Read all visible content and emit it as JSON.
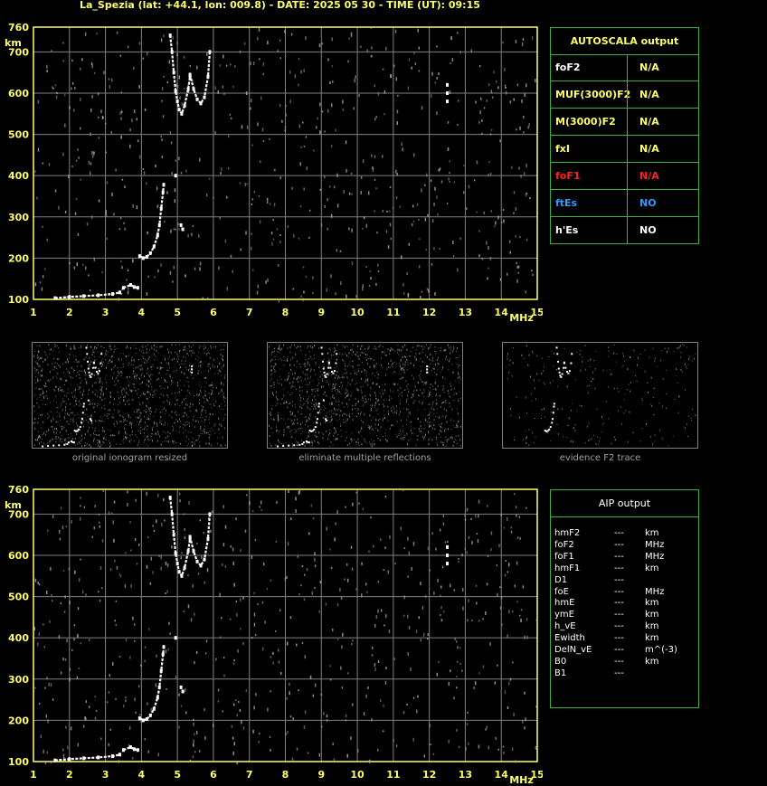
{
  "title": "La_Spezia (lat: +44.1, lon: 009.8) - DATE: 2025 05 30 - TIME (UT): 09:15",
  "colors": {
    "axis": "#ffff66",
    "grid": "#808080",
    "panel_border": "#3cb043",
    "trace": "#ffffff",
    "noise": "#b0b0b0"
  },
  "chart_data": [
    {
      "type": "scatter",
      "name": "main-ionogram",
      "xlabel": "MHz",
      "ylabel": "km",
      "xlim": [
        1,
        15
      ],
      "ylim": [
        100,
        760
      ],
      "x_ticks": [
        1,
        2,
        3,
        4,
        5,
        6,
        7,
        8,
        9,
        10,
        11,
        12,
        13,
        14,
        15
      ],
      "y_ticks": [
        100,
        200,
        300,
        400,
        500,
        600,
        700,
        760
      ],
      "grid": true,
      "traces": [
        {
          "label": "E-low",
          "points": [
            [
              1.6,
              103
            ],
            [
              2.0,
              106
            ],
            [
              2.4,
              108
            ],
            [
              2.8,
              110
            ],
            [
              3.2,
              113
            ],
            [
              3.4,
              117
            ]
          ]
        },
        {
          "label": "Es-low",
          "points": [
            [
              3.5,
              128
            ],
            [
              3.7,
              135
            ],
            [
              3.8,
              130
            ],
            [
              3.9,
              128
            ]
          ]
        },
        {
          "label": "F1",
          "points": [
            [
              3.95,
              205
            ],
            [
              4.05,
              200
            ],
            [
              4.15,
              203
            ],
            [
              4.25,
              212
            ],
            [
              4.35,
              228
            ],
            [
              4.45,
              255
            ],
            [
              4.5,
              280
            ],
            [
              4.55,
              320
            ],
            [
              4.6,
              360
            ],
            [
              4.62,
              378
            ]
          ]
        },
        {
          "label": "F2-o",
          "points": [
            [
              4.8,
              740
            ],
            [
              4.85,
              700
            ],
            [
              4.9,
              650
            ],
            [
              4.95,
              605
            ],
            [
              5.0,
              580
            ],
            [
              5.05,
              560
            ],
            [
              5.12,
              550
            ],
            [
              5.2,
              570
            ],
            [
              5.3,
              610
            ],
            [
              5.35,
              640
            ]
          ]
        },
        {
          "label": "F2-x",
          "points": [
            [
              5.35,
              645
            ],
            [
              5.45,
              610
            ],
            [
              5.55,
              585
            ],
            [
              5.65,
              575
            ],
            [
              5.75,
              590
            ],
            [
              5.85,
              640
            ],
            [
              5.9,
              700
            ]
          ]
        },
        {
          "label": "spur",
          "points": [
            [
              4.95,
              400
            ],
            [
              5.1,
              280
            ],
            [
              5.15,
              270
            ],
            [
              12.5,
              620
            ],
            [
              12.5,
              600
            ],
            [
              12.5,
              580
            ]
          ]
        }
      ]
    },
    {
      "type": "scatter",
      "name": "aip-ionogram",
      "xlabel": "MHz",
      "ylabel": "km",
      "xlim": [
        1,
        15
      ],
      "ylim": [
        100,
        760
      ],
      "x_ticks": [
        1,
        2,
        3,
        4,
        5,
        6,
        7,
        8,
        9,
        10,
        11,
        12,
        13,
        14,
        15
      ],
      "y_ticks": [
        100,
        200,
        300,
        400,
        500,
        600,
        700,
        760
      ],
      "grid": true
    }
  ],
  "thumbnails": [
    {
      "caption": "original ionogram resized"
    },
    {
      "caption": "eliminate multiple reflections"
    },
    {
      "caption": "evidence F2 trace"
    }
  ],
  "autoscala": {
    "header": "AUTOSCALA output",
    "rows": [
      {
        "key": "foF2",
        "value": "N/A",
        "key_color": "#ffffff",
        "value_color": "#ffff66"
      },
      {
        "key": "MUF(3000)F2",
        "value": "N/A",
        "key_color": "#ffff66",
        "value_color": "#ffff66"
      },
      {
        "key": "M(3000)F2",
        "value": "N/A",
        "key_color": "#ffff66",
        "value_color": "#ffff66"
      },
      {
        "key": "fxI",
        "value": "N/A",
        "key_color": "#ffff66",
        "value_color": "#ffff66"
      },
      {
        "key": "foF1",
        "value": "N/A",
        "key_color": "#ff2020",
        "value_color": "#ff2020"
      },
      {
        "key": "ftEs",
        "value": "NO",
        "key_color": "#3399ff",
        "value_color": "#3399ff"
      },
      {
        "key": "h'Es",
        "value": "NO",
        "key_color": "#ffffff",
        "value_color": "#ffffff"
      }
    ]
  },
  "aip": {
    "header": "AIP output",
    "rows": [
      {
        "param": "hmF2",
        "value": "---",
        "unit": "km"
      },
      {
        "param": "foF2",
        "value": "---",
        "unit": "MHz"
      },
      {
        "param": "foF1",
        "value": "---",
        "unit": "MHz"
      },
      {
        "param": "hmF1",
        "value": "---",
        "unit": "km"
      },
      {
        "param": "D1",
        "value": "---",
        "unit": ""
      },
      {
        "param": "foE",
        "value": "---",
        "unit": "MHz"
      },
      {
        "param": "hmE",
        "value": "---",
        "unit": "km"
      },
      {
        "param": "ymE",
        "value": "---",
        "unit": "km"
      },
      {
        "param": "h_vE",
        "value": "---",
        "unit": "km"
      },
      {
        "param": "Ewidth",
        "value": "---",
        "unit": "km"
      },
      {
        "param": "DelN_vE",
        "value": "---",
        "unit": "m^(-3)"
      },
      {
        "param": "B0",
        "value": "---",
        "unit": "km"
      },
      {
        "param": "B1",
        "value": "---",
        "unit": ""
      }
    ]
  }
}
